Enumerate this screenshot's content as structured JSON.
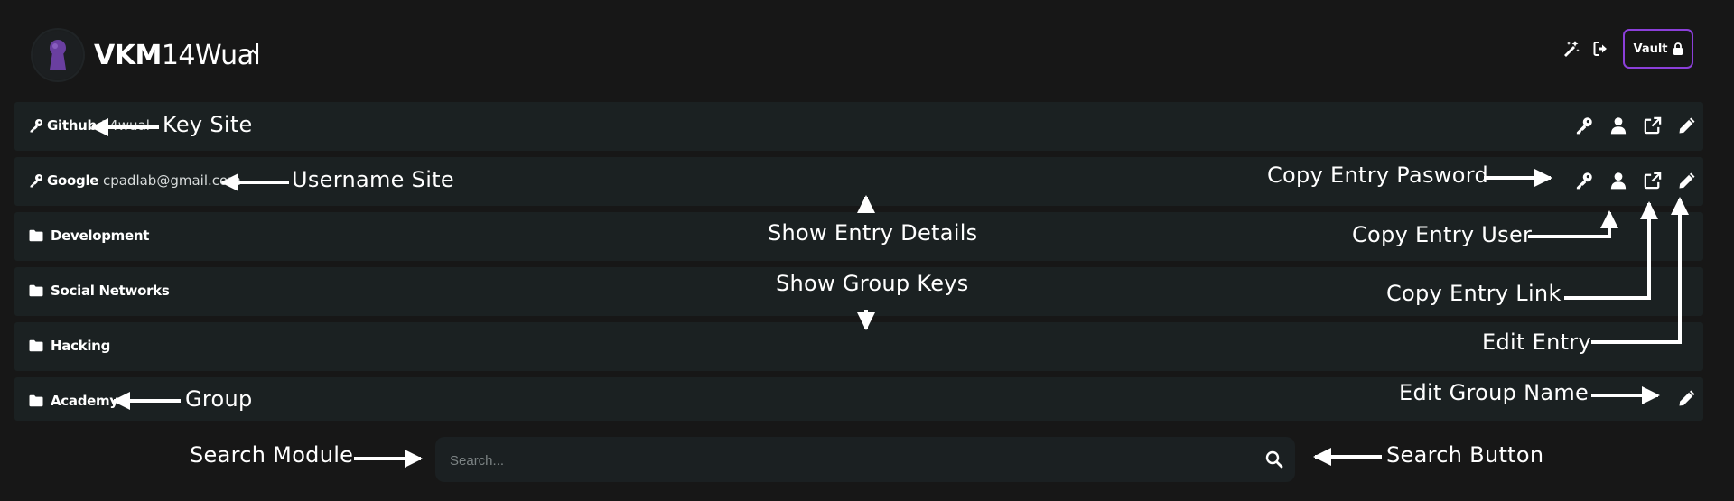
{
  "header": {
    "title_bold": "VKM",
    "title_rest": "14Wual",
    "vault_label": "Vault"
  },
  "entries": [
    {
      "type": "key",
      "name": "Github",
      "username": "14wual"
    },
    {
      "type": "key",
      "name": "Google",
      "username": "cpadlab@gmail.com"
    }
  ],
  "groups": [
    "Development",
    "Social Networks",
    "Hacking",
    "Academy"
  ],
  "search": {
    "placeholder": "Search..."
  },
  "annotations": {
    "key_site": "Key Site",
    "username_site": "Username Site",
    "show_entry_details": "Show Entry Details",
    "show_group_keys": "Show Group Keys",
    "group": "Group",
    "copy_entry_password": "Copy Entry Pasword",
    "copy_entry_user": "Copy Entry User",
    "copy_entry_link": "Copy Entry Link",
    "edit_entry": "Edit Entry",
    "edit_group_name": "Edit Group Name",
    "search_module": "Search Module",
    "search_button": "Search Button"
  },
  "colors": {
    "background": "#171717",
    "row": "#1b2122",
    "accent": "#8b3fd9",
    "logo": "#6a3fa0"
  },
  "icons": [
    "keyhole-logo-icon",
    "chevron-up-icon",
    "magic-wand-icon",
    "logout-icon",
    "lock-icon",
    "key-icon",
    "user-icon",
    "external-link-icon",
    "pencil-icon",
    "folder-icon",
    "search-icon"
  ]
}
